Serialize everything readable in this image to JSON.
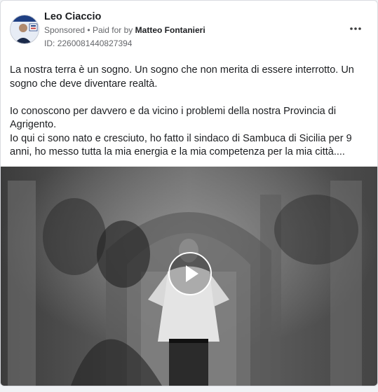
{
  "post": {
    "author": "Leo Ciaccio",
    "sponsored": "Sponsored",
    "separator": "•",
    "paid_for_prefix": "Paid for by",
    "paid_for_by": "Matteo Fontanieri",
    "id_label": "ID:",
    "id_value": "2260081440827394",
    "more_icon": "more-options-icon",
    "paragraphs": [
      "La nostra terra è un sogno. Un sogno che non merita di essere interrotto. Un sogno che deve diventare realtà.",
      "Io conoscono per davvero e da vicino i problemi della nostra Provincia di Agrigento.",
      "Io qui ci sono nato e cresciuto, ho fatto il sindaco di Sambuca di Sicilia per 9 anni, ho messo tutta la mia energia e la mia competenza per la mia città...."
    ],
    "media": {
      "type": "video",
      "play_icon": "play-icon",
      "colors": {
        "overlay": "#ffffff"
      }
    }
  }
}
